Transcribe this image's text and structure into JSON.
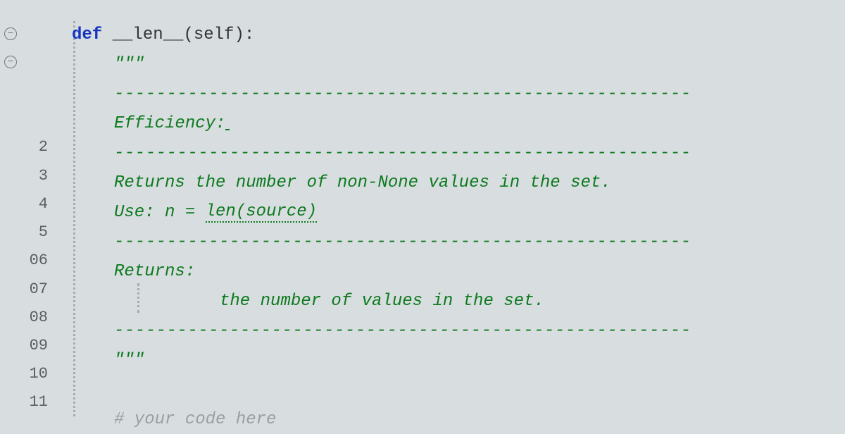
{
  "gutter": {
    "lines": [
      "",
      "",
      "",
      "",
      "2",
      "3",
      "4",
      "5",
      "6",
      "7",
      "8",
      "9",
      "10",
      "11"
    ],
    "display": [
      "",
      "",
      "",
      "",
      "2",
      "3",
      "4",
      "5",
      "06",
      "07",
      "08",
      "09",
      "10",
      "11"
    ]
  },
  "fold": {
    "line0": "⊖",
    "line1": "⊖"
  },
  "code": {
    "def_kw": "def ",
    "fn_name": "__len__",
    "fn_params": "(self):",
    "triple_open": "\"\"\"",
    "separator": "-------------------------------------------------------",
    "efficiency_label": "Efficiency:",
    "returns_desc": "Returns the number of non-None values in the set.",
    "use_prefix": "Use: n = ",
    "use_call": "len(source)",
    "returns_label": "Returns:",
    "returns_detail": "the number of values in the set.",
    "triple_close": "\"\"\"",
    "comment": "# your code here"
  }
}
